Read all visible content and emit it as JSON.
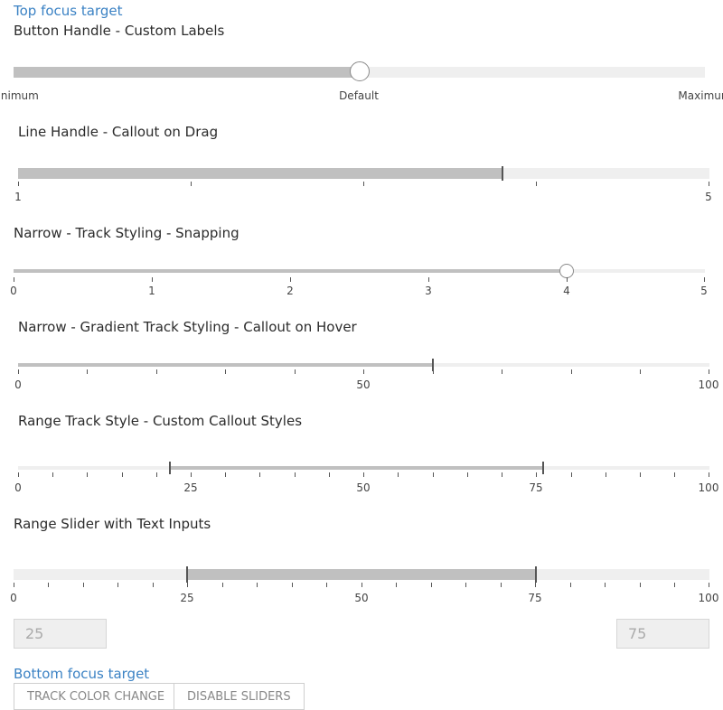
{
  "focus": {
    "top": "Top focus target",
    "bottom": "Bottom focus target"
  },
  "sliders": {
    "s1": {
      "title": "Button Handle - Custom Labels",
      "labels": [
        "Minimum",
        "Default",
        "Maximum"
      ],
      "value_fraction": 0.5
    },
    "s2": {
      "title": "Line Handle - Callout on Drag",
      "min_label": "1",
      "max_label": "5",
      "value": 3.8
    },
    "s3": {
      "title": "Narrow - Track Styling - Snapping",
      "labels": [
        "0",
        "1",
        "2",
        "3",
        "4",
        "5"
      ],
      "value": 4
    },
    "s4": {
      "title": "Narrow - Gradient Track Styling - Callout on Hover",
      "labels": [
        "0",
        "50",
        "100"
      ],
      "value": 60
    },
    "s5": {
      "title": "Range Track Style - Custom Callout Styles",
      "labels": [
        "0",
        "25",
        "50",
        "75",
        "100"
      ],
      "low": 22,
      "high": 76
    },
    "s6": {
      "title": "Range Slider with Text Inputs",
      "labels": [
        "0",
        "25",
        "50",
        "75",
        "100"
      ],
      "low": 25,
      "high": 75
    }
  },
  "inputs": {
    "low_value": "25",
    "high_value": "75"
  },
  "buttons": {
    "track_color": "TRACK COLOR CHANGE",
    "disable": "DISABLE SLIDERS"
  },
  "colors": {
    "link": "#3b82c4",
    "track": "#efefef",
    "fill": "#c0c0c0"
  }
}
